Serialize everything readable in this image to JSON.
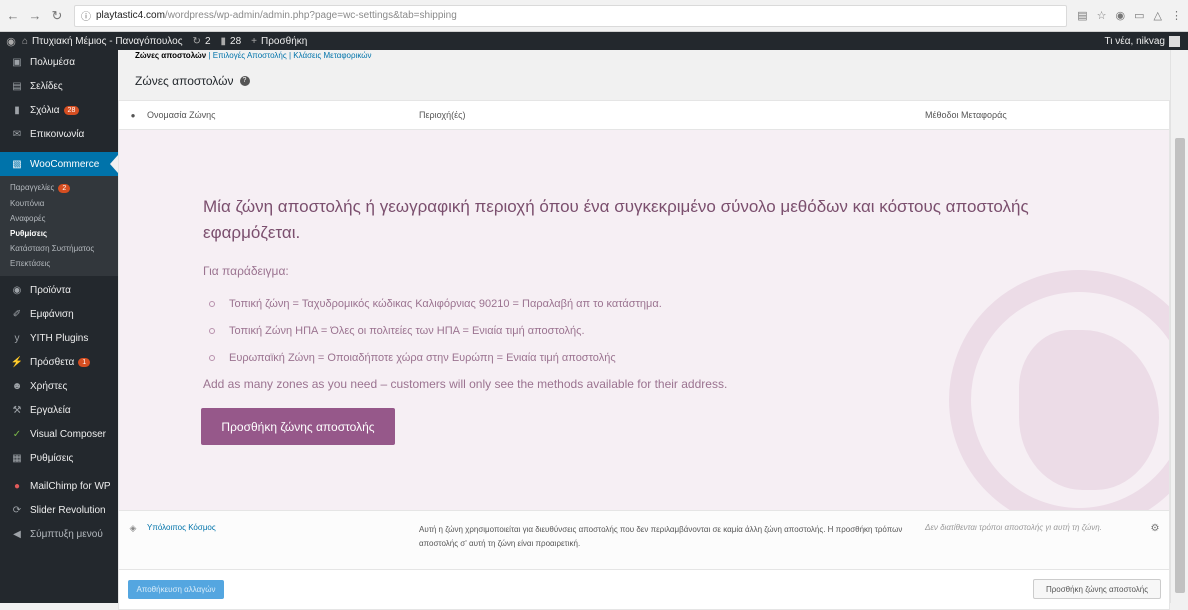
{
  "browser": {
    "url_domain": "playtastic4.com",
    "url_path": "/wordpress/wp-admin/admin.php?page=wc-settings&tab=shipping"
  },
  "adminbar": {
    "site_name": "Πτυχιακή Μέμιος - Παναγόπουλος",
    "updates": "2",
    "comments": "28",
    "new": "Προσθήκη",
    "greeting": "Τι νέα, nikvag"
  },
  "sidebar": {
    "items_top": [
      {
        "label": "Πολυμέσα",
        "icon": "media-icon"
      },
      {
        "label": "Σελίδες",
        "icon": "pages-icon"
      },
      {
        "label": "Σχόλια",
        "icon": "comments-icon",
        "badge": "28"
      },
      {
        "label": "Επικοινωνία",
        "icon": "contact-icon"
      }
    ],
    "woocommerce": "WooCommerce",
    "sub_items": [
      {
        "label": "Παραγγελίες",
        "badge": "2"
      },
      {
        "label": "Κουπόνια"
      },
      {
        "label": "Αναφορές"
      },
      {
        "label": "Ρυθμίσεις"
      },
      {
        "label": "Κατάσταση Συστήματος"
      },
      {
        "label": "Επεκτάσεις"
      }
    ],
    "items_bottom": [
      {
        "label": "Προϊόντα",
        "icon": "products-icon"
      },
      {
        "label": "Εμφάνιση",
        "icon": "appearance-icon"
      },
      {
        "label": "YITH Plugins",
        "icon": "yith-icon"
      },
      {
        "label": "Πρόσθετα",
        "icon": "plugins-icon",
        "badge": "1"
      },
      {
        "label": "Χρήστες",
        "icon": "users-icon"
      },
      {
        "label": "Εργαλεία",
        "icon": "tools-icon"
      },
      {
        "label": "Visual Composer",
        "icon": "visual-composer-icon"
      },
      {
        "label": "Ρυθμίσεις",
        "icon": "settings-icon"
      },
      {
        "label": "MailChimp for WP",
        "icon": "mailchimp-icon"
      },
      {
        "label": "Slider Revolution",
        "icon": "slider-icon"
      },
      {
        "label": "Σύμπτυξη μενού",
        "icon": "collapse-icon"
      }
    ]
  },
  "subnav": {
    "current": "Ζώνες αποστολών",
    "links": [
      "Επιλογές Αποστολής",
      "Κλάσεις Μεταφορικών"
    ]
  },
  "page_title": "Ζώνες αποστολών",
  "table": {
    "col_name": "Ονομασία Ζώνης",
    "col_region": "Περιοχή(ές)",
    "col_methods": "Μέθοδοι Μεταφοράς"
  },
  "blank_state": {
    "title": "Μία ζώνη αποστολής ή γεωγραφική περιοχή όπου ένα συγκεκριμένο σύνολο μεθόδων και κόστους αποστολής εφαρμόζεται.",
    "example_label": "Για παράδειγμα:",
    "examples": [
      "Τοπική ζώνη = Ταχυδρομικός κώδικας Καλιφόρνιας 90210 = Παραλαβή απ το κατάστημα.",
      "Τοπική Ζώνη ΗΠΑ = Όλες οι πολιτείες των ΗΠΑ = Ενιαία τιμή αποστολής.",
      "Ευρωπαϊκή Ζώνη = Οποιαδήποτε χώρα στην Ευρώπη = Ενιαία τιμή αποστολής"
    ],
    "add_text": "Add as many zones as you need – customers will only see the methods available for their address.",
    "button": "Προσθήκη ζώνης αποστολής"
  },
  "rest_of_world": {
    "name": "Υπόλοιπος Κόσμος",
    "description": "Αυτή η ζώνη χρησιμοποιείται για διευθύνσεις αποστολής που δεν περιλαμβάνονται σε καμία άλλη ζώνη αποστολής. Η προσθήκη τρόπων αποστολής σ' αυτή τη ζώνη είναι προαιρετική.",
    "methods": "Δεν διατίθενται τρόποι αποστολής γι αυτή τη ζώνη."
  },
  "footer": {
    "save": "Αποθήκευση αλλαγών",
    "add_zone": "Προσθήκη ζώνης αποστολής"
  },
  "colors": {
    "accent": "#0073aa",
    "woo_purple": "#96588a",
    "blank_bg": "#f6eff4"
  }
}
